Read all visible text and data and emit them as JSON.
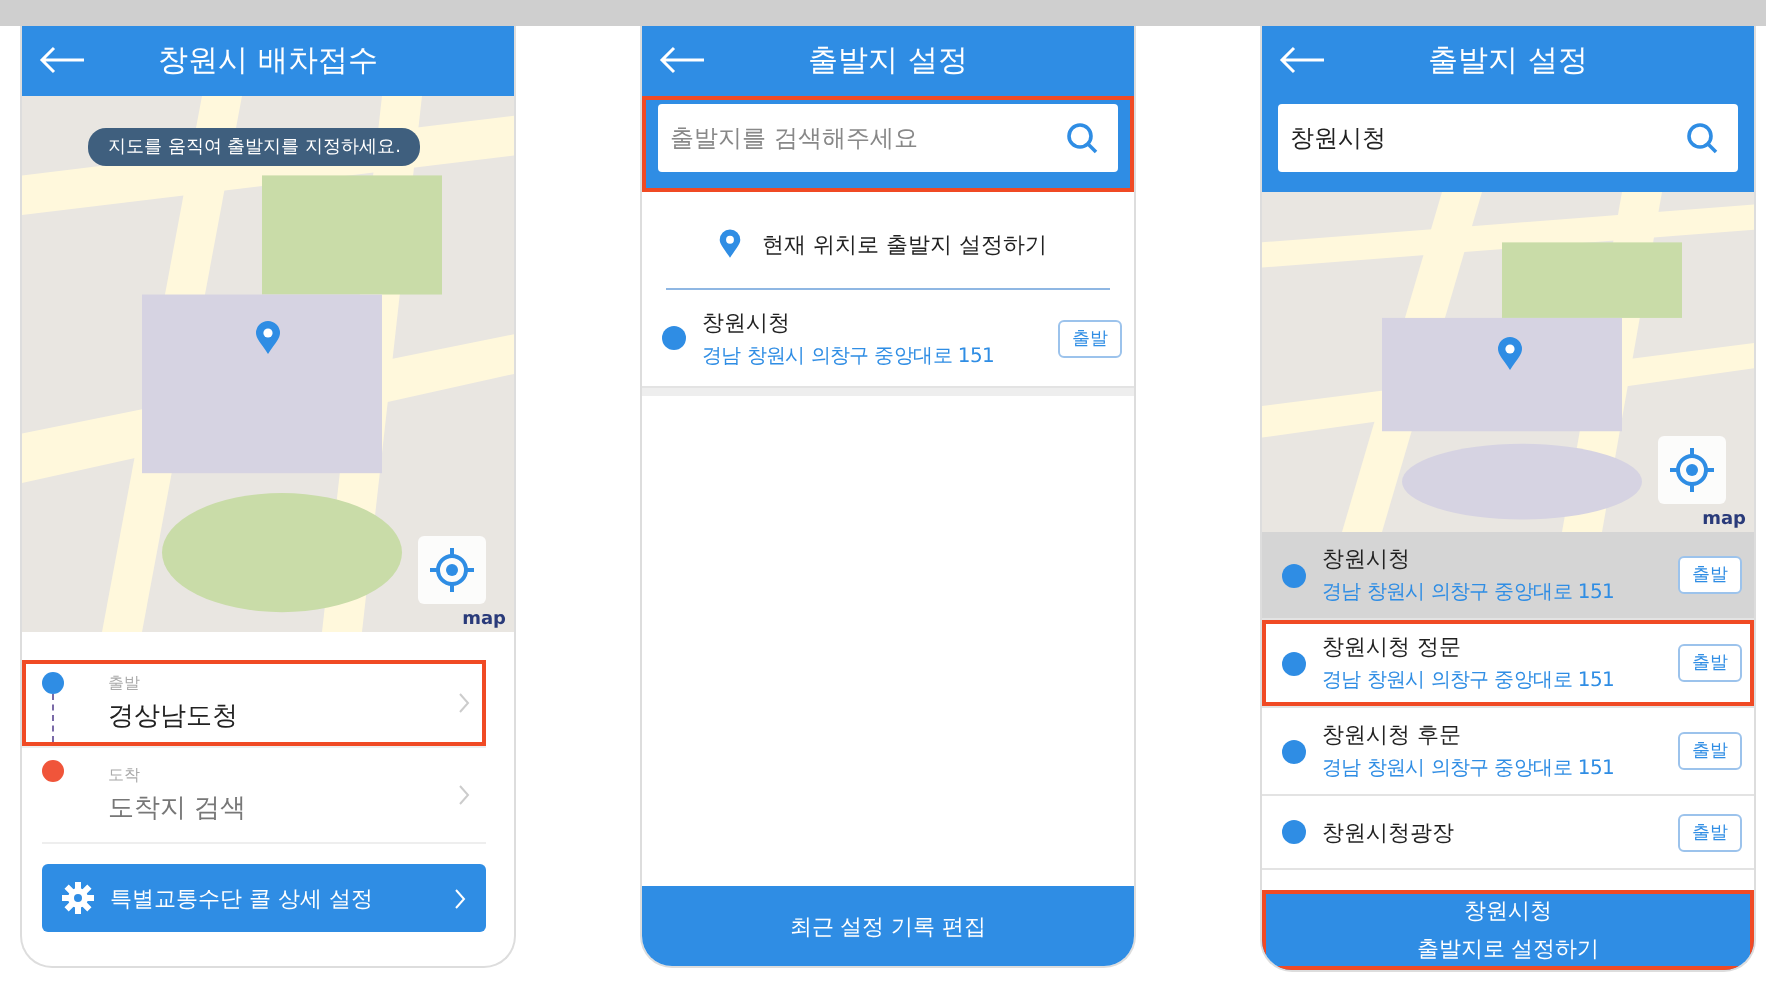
{
  "screens": [
    {
      "kind": "map_request",
      "title": "창원시 배차접수",
      "map": {
        "hint": "지도를 움직여 출발지를 지정하세요.",
        "logo": "map"
      },
      "route": [
        {
          "kind": "departure",
          "label": "출발",
          "value": "경상남도청",
          "filled": true,
          "highlighted": true,
          "color": "#2f8de4"
        },
        {
          "kind": "arrival",
          "label": "도착",
          "value": "도착지 검색",
          "filled": false,
          "highlighted": false,
          "color": "#f0553a"
        }
      ],
      "settings_button": "특별교통수단 콜 상세 설정"
    },
    {
      "kind": "search",
      "title": "출발지 설정",
      "search": {
        "placeholder": "출발지를 검색해주세요",
        "highlighted": true
      },
      "current_location": "현재 위치로 출발지 설정하기",
      "results": [
        {
          "name": "창원시청",
          "address": "경남 창원시 의창구 중앙대로 151",
          "action": "출발",
          "selected": false,
          "highlighted": false
        }
      ],
      "footer": {
        "lines": [
          "최근 설정 기록 편집"
        ],
        "highlighted": false
      }
    },
    {
      "kind": "search_map",
      "title": "출발지 설정",
      "search": {
        "value": "창원시청",
        "highlighted": false
      },
      "map": {
        "logo": "map"
      },
      "results": [
        {
          "name": "창원시청",
          "address": "경남 창원시 의창구 중앙대로 151",
          "action": "출발",
          "selected": true,
          "highlighted": false
        },
        {
          "name": "창원시청 정문",
          "address": "경남 창원시 의창구 중앙대로 151",
          "action": "출발",
          "selected": false,
          "highlighted": true
        },
        {
          "name": "창원시청 후문",
          "address": "경남 창원시 의창구 중앙대로 151",
          "action": "출발",
          "selected": false,
          "highlighted": false
        },
        {
          "name": "창원시청광장",
          "action": "출발",
          "selected": false,
          "highlighted": false
        }
      ],
      "footer": {
        "lines": [
          "창원시청",
          "출발지로 설정하기"
        ],
        "highlighted": true
      }
    }
  ]
}
